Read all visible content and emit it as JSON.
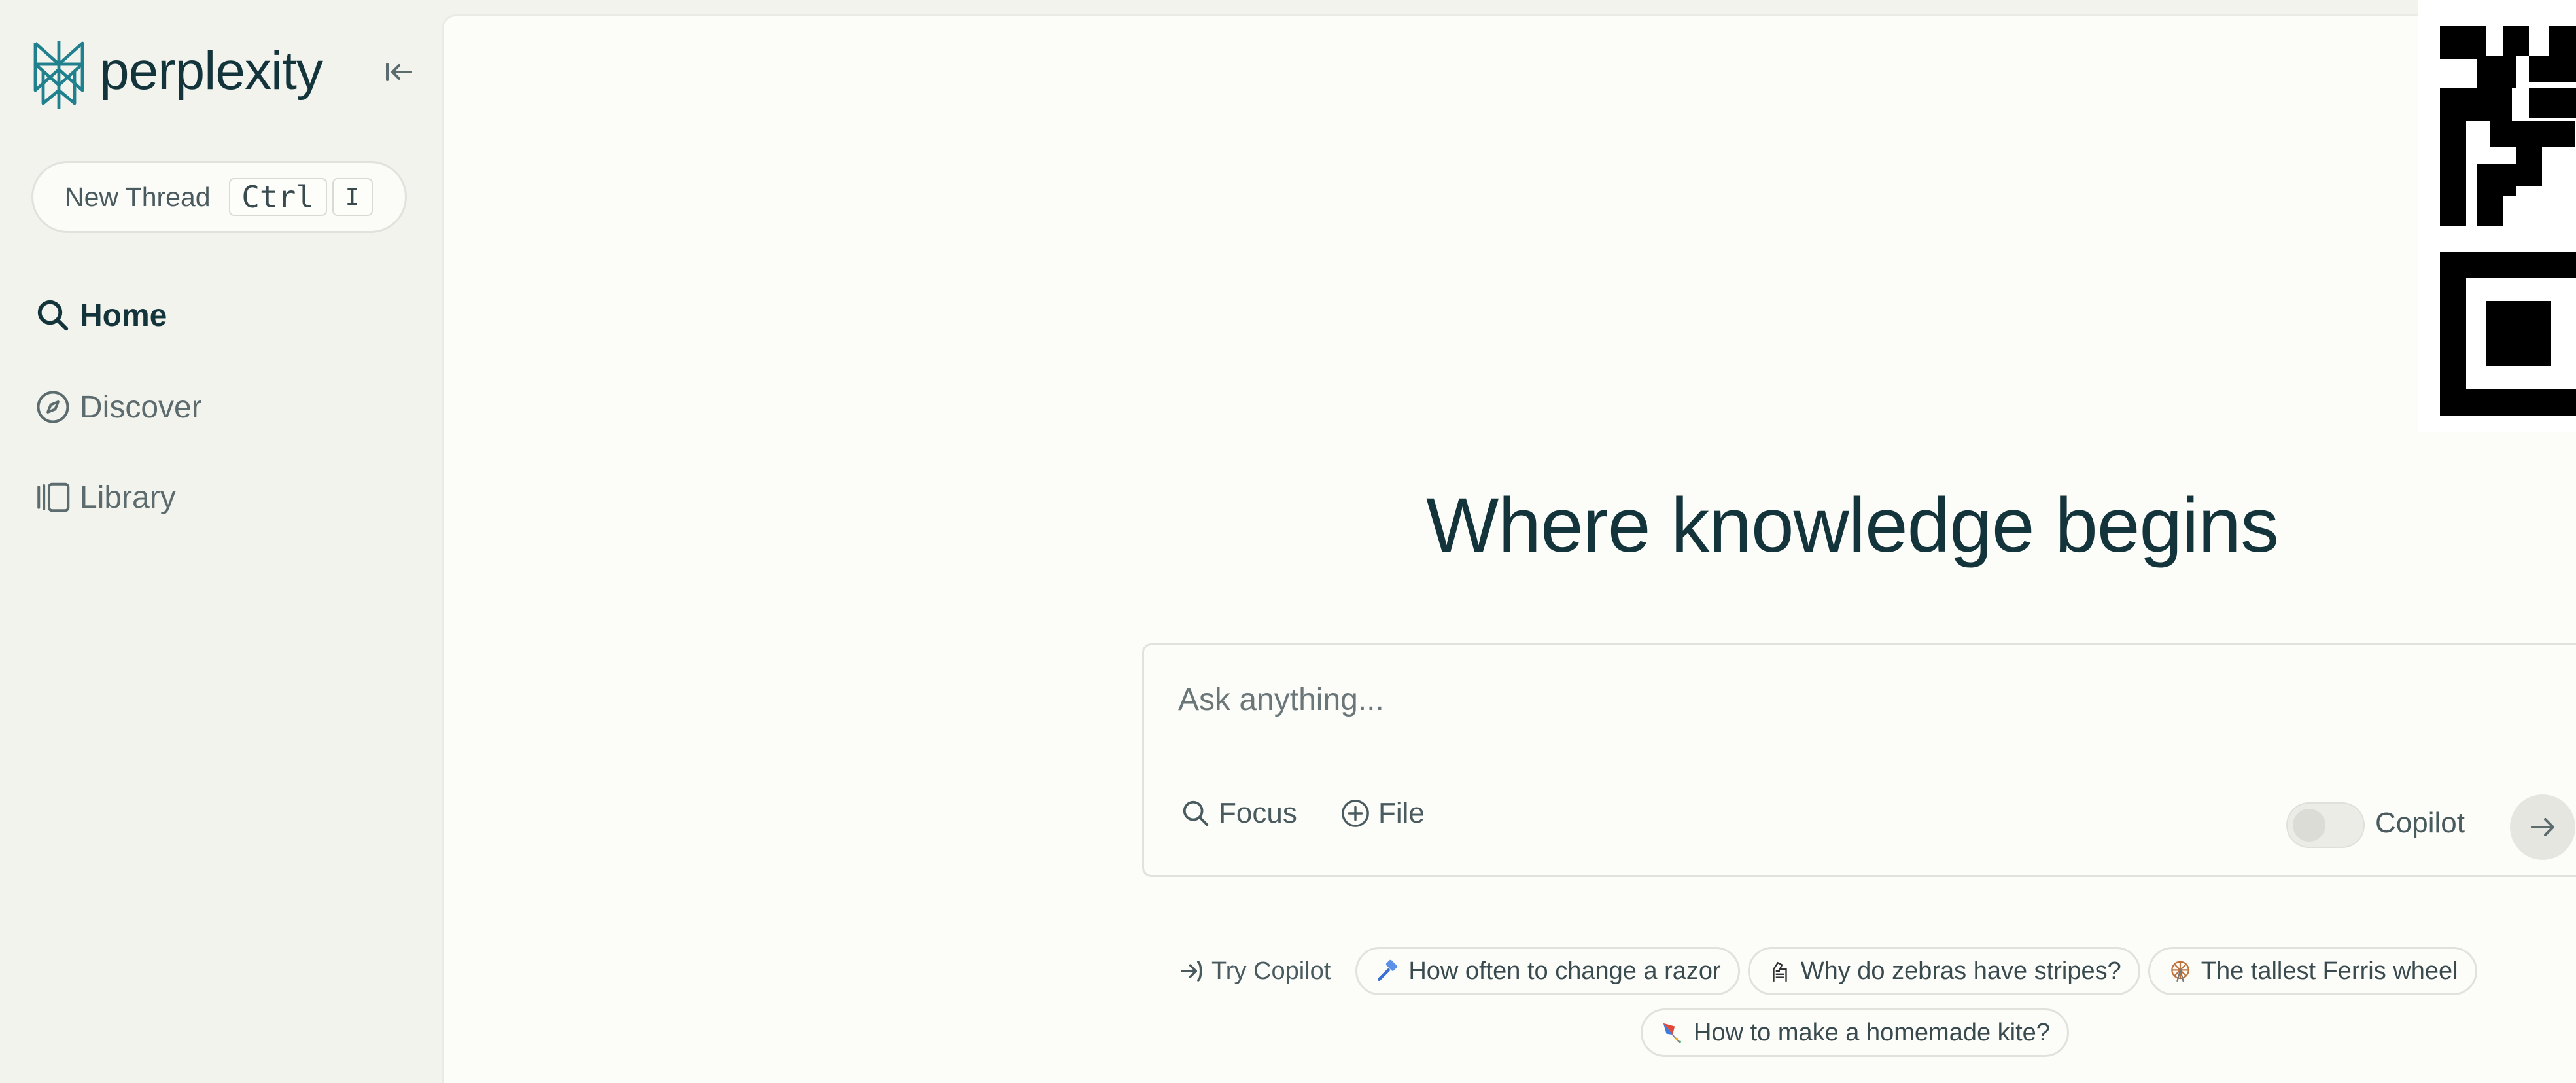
{
  "app": {
    "brand": "perplexity",
    "colors": {
      "brand_teal": "#20808d",
      "text_dark": "#13343b",
      "sidebar_bg": "#f3f3ee",
      "main_bg": "#fcfcf9"
    }
  },
  "sidebar": {
    "new_thread": {
      "label": "New Thread",
      "shortcut_key1": "Ctrl",
      "shortcut_key2": "I"
    },
    "nav": [
      {
        "label": "Home",
        "icon": "search-icon",
        "active": true
      },
      {
        "label": "Discover",
        "icon": "compass-icon",
        "active": false
      },
      {
        "label": "Library",
        "icon": "library-icon",
        "active": false
      }
    ],
    "collapse_icon": "collapse-left-icon"
  },
  "main": {
    "headline": "Where knowledge begins",
    "search": {
      "placeholder": "Ask anything...",
      "focus_label": "Focus",
      "file_label": "File",
      "copilot_label": "Copilot",
      "copilot_on": false,
      "submit_icon": "arrow-right-icon"
    },
    "try_copilot_label": "Try Copilot",
    "suggestions": [
      {
        "label": "How often to change a razor",
        "icon": "razor-emoji"
      },
      {
        "label": "Why do zebras have stripes?",
        "icon": "zebra-emoji"
      },
      {
        "label": "The tallest Ferris wheel",
        "icon": "ferris-wheel-emoji"
      },
      {
        "label": "How to make a homemade kite?",
        "icon": "kite-emoji"
      }
    ]
  }
}
